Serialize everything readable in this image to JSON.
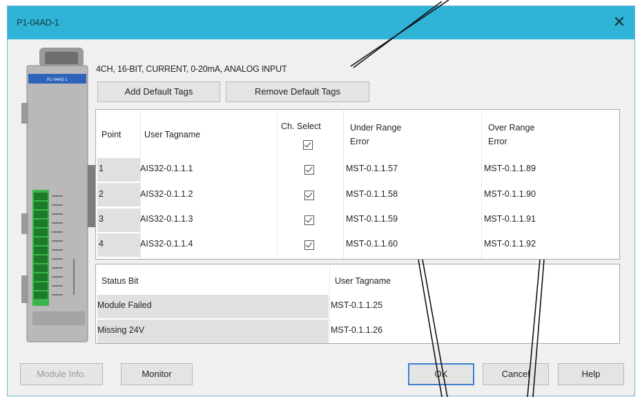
{
  "window": {
    "title": "P1-04AD-1",
    "close_glyph": "✕"
  },
  "module": {
    "label": "P1-04AD-1"
  },
  "description": "4CH, 16-BIT, CURRENT, 0-20mA, ANALOG INPUT",
  "buttons": {
    "add_default": "Add Default Tags",
    "remove_default": "Remove Default Tags",
    "module_info": "Module Info.",
    "monitor": "Monitor",
    "ok": "OK",
    "cancel": "Cancel",
    "help": "Help"
  },
  "points_table": {
    "headers": {
      "point": "Point",
      "user_tagname": "User Tagname",
      "ch_select": "Ch. Select",
      "under_range": [
        "Under Range",
        "Error"
      ],
      "over_range": [
        "Over Range",
        "Error"
      ]
    },
    "rows": [
      {
        "point": "1",
        "tag": "AIS32-0.1.1.1",
        "checked": true,
        "under": "MST-0.1.1.57",
        "over": "MST-0.1.1.89"
      },
      {
        "point": "2",
        "tag": "AIS32-0.1.1.2",
        "checked": true,
        "under": "MST-0.1.1.58",
        "over": "MST-0.1.1.90"
      },
      {
        "point": "3",
        "tag": "AIS32-0.1.1.3",
        "checked": true,
        "under": "MST-0.1.1.59",
        "over": "MST-0.1.1.91"
      },
      {
        "point": "4",
        "tag": "AIS32-0.1.1.4",
        "checked": true,
        "under": "MST-0.1.1.60",
        "over": "MST-0.1.1.92"
      }
    ]
  },
  "status_table": {
    "headers": {
      "status_bit": "Status Bit",
      "user_tagname": "User Tagname"
    },
    "rows": [
      {
        "bit": "Module Failed",
        "tag": "MST-0.1.1.25"
      },
      {
        "bit": "Missing 24V",
        "tag": "MST-0.1.1.26"
      }
    ]
  },
  "colors": {
    "titlebar": "#2fb3d6",
    "dialog_bg": "#f0f0f0",
    "module_green": "#3bb54a",
    "ok_border": "#3a7fd0"
  }
}
